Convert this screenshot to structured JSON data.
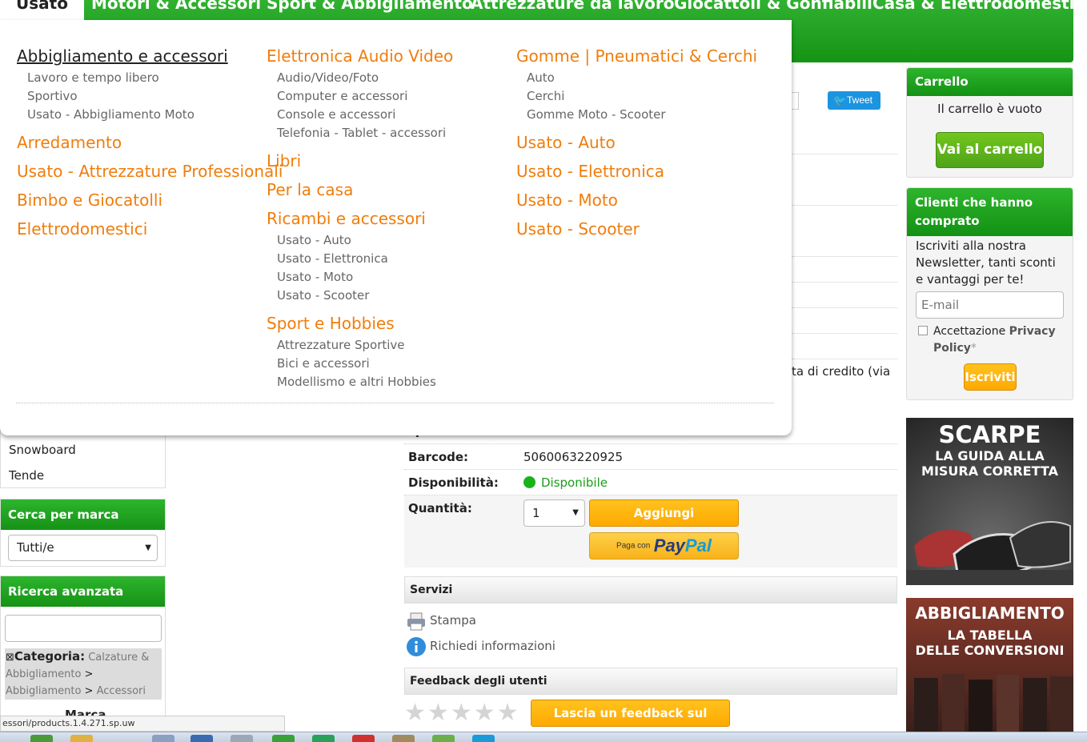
{
  "topnav": {
    "items": [
      "Usato",
      "Motori & Accessori",
      "Sport & Abbigliamento",
      "Attrezzature da lavoro",
      "Giocattoli & Gonfiabili",
      "Casa & Elettrodomestici"
    ]
  },
  "megamenu": {
    "col1": {
      "heading": "Abbigliamento e accessori",
      "subs": [
        "Lavoro e tempo libero",
        "Sportivo",
        "Usato - Abbigliamento Moto"
      ],
      "others": [
        "Arredamento",
        "Usato - Attrezzature Professionali",
        "Bimbo e Giocatolli",
        "Elettrodomestici"
      ]
    },
    "col2": {
      "h1": "Elettronica Audio Video",
      "subs1": [
        "Audio/Video/Foto",
        "Computer e accessori",
        "Console e accessori",
        "Telefonia - Tablet - accessori"
      ],
      "h2": "Libri",
      "h3": "Per la casa",
      "h4": "Ricambi e accessori",
      "subs4": [
        "Usato - Auto",
        "Usato - Elettronica",
        "Usato - Moto",
        "Usato - Scooter"
      ],
      "h5": "Sport e Hobbies",
      "subs5": [
        "Attrezzature Sportive",
        "Bici e accessori",
        "Modellismo e altri Hobbies"
      ]
    },
    "col3": {
      "heading": "Gomme | Pneumatici & Cerchi",
      "subs": [
        "Auto",
        "Cerchi",
        "Gomme Moto - Scooter"
      ],
      "others": [
        "Usato - Auto",
        "Usato - Elettronica",
        "Usato - Moto",
        "Usato - Scooter"
      ]
    }
  },
  "sidebar": {
    "categories": [
      "Snowboard",
      "Tende"
    ],
    "brand": {
      "title": "Cerca per marca",
      "selected": "Tutti/e"
    },
    "advanced": {
      "title": "Ricerca avanzata",
      "filter_close": "⊠",
      "filter_label": "Categoria:",
      "filter_path1": "Calzature &",
      "filter_path2": "Abbigliamento",
      "filter_sep1": ">",
      "filter_path3": "Abbigliamento",
      "filter_sep2": ">",
      "filter_path4": "Accessori",
      "next_label": "Marca"
    }
  },
  "product": {
    "tweet": "Tweet",
    "payment_fragment": "ta di credito (via",
    "shipping_fragment": "spedizione:",
    "barcode_label": "Barcode:",
    "barcode_value": "5060063220925",
    "availability_label": "Disponibilità:",
    "availability_value": "Disponibile",
    "quantity_label": "Quantità:",
    "quantity_value": "1",
    "add_button": "Aggiungi",
    "paypal_prefix": "Paga con",
    "paypal_word1": "Pay",
    "paypal_word2": "Pal",
    "services_title": "Servizi",
    "print": "Stampa",
    "info": "Richiedi informazioni",
    "feedback_title": "Feedback degli utenti",
    "feedback_button": "Lascia un feedback sul prodotto",
    "rating": 0
  },
  "cart": {
    "title": "Carrello",
    "empty": "Il carrello è vuoto",
    "button": "Vai al carrello"
  },
  "newsletter": {
    "title": "Clienti che hanno comprato",
    "text": "Iscriviti alla nostra Newsletter, tanti sconti e vantaggi per te!",
    "placeholder": "E-mail",
    "consent_prefix": "Accettazione",
    "consent_link": "Privacy Policy",
    "consent_mark": "*",
    "button": "Iscriviti"
  },
  "banners": {
    "b1_line1": "SCARPE",
    "b1_line2": "LA GUIDA  ALLA",
    "b1_line3": "MISURA CORRETTA",
    "b2_line1": "ABBIGLIAMENTO",
    "b2_line2": "LA TABELLA",
    "b2_line3": "DELLE CONVERSIONI"
  },
  "status_url": "essori/products.1.4.271.sp.uw",
  "colors": {
    "green": "#1a9c1a",
    "orange": "#f07d0c",
    "button_orange": "#ffae00"
  }
}
